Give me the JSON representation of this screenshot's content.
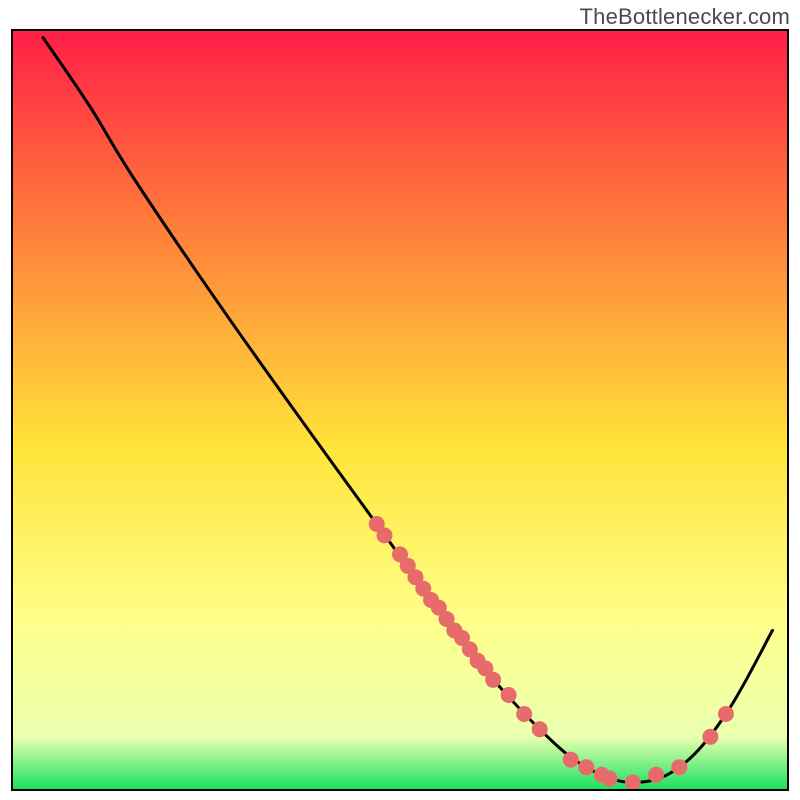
{
  "attribution": "TheBottlenecker.com",
  "chart_data": {
    "type": "line",
    "title": "",
    "xlabel": "",
    "ylabel": "",
    "xlim": [
      0,
      100
    ],
    "ylim": [
      0,
      100
    ],
    "background": {
      "type": "vertical-gradient",
      "stops": [
        {
          "offset": 0.0,
          "color": "#ff1e47"
        },
        {
          "offset": 0.25,
          "color": "#ff7a3a"
        },
        {
          "offset": 0.55,
          "color": "#ffe43a"
        },
        {
          "offset": 0.78,
          "color": "#ffff8a"
        },
        {
          "offset": 0.93,
          "color": "#eaffb0"
        },
        {
          "offset": 1.0,
          "color": "#18e060"
        }
      ]
    },
    "series": [
      {
        "name": "bottleneck-curve",
        "color": "#000000",
        "points": [
          {
            "x": 4,
            "y": 99
          },
          {
            "x": 10,
            "y": 90
          },
          {
            "x": 16,
            "y": 80
          },
          {
            "x": 28,
            "y": 62
          },
          {
            "x": 42,
            "y": 42
          },
          {
            "x": 52,
            "y": 28
          },
          {
            "x": 60,
            "y": 17
          },
          {
            "x": 68,
            "y": 8
          },
          {
            "x": 74,
            "y": 3
          },
          {
            "x": 80,
            "y": 1
          },
          {
            "x": 86,
            "y": 3
          },
          {
            "x": 92,
            "y": 10
          },
          {
            "x": 98,
            "y": 21
          }
        ]
      }
    ],
    "markers": {
      "name": "data-markers",
      "color": "#e86b6b",
      "radius": 8,
      "points": [
        {
          "x": 47,
          "y": 35
        },
        {
          "x": 48,
          "y": 33.5
        },
        {
          "x": 50,
          "y": 31
        },
        {
          "x": 51,
          "y": 29.5
        },
        {
          "x": 52,
          "y": 28
        },
        {
          "x": 53,
          "y": 26.5
        },
        {
          "x": 54,
          "y": 25
        },
        {
          "x": 55,
          "y": 24
        },
        {
          "x": 56,
          "y": 22.5
        },
        {
          "x": 57,
          "y": 21
        },
        {
          "x": 58,
          "y": 20
        },
        {
          "x": 59,
          "y": 18.5
        },
        {
          "x": 60,
          "y": 17
        },
        {
          "x": 61,
          "y": 16
        },
        {
          "x": 62,
          "y": 14.5
        },
        {
          "x": 64,
          "y": 12.5
        },
        {
          "x": 66,
          "y": 10
        },
        {
          "x": 68,
          "y": 8
        },
        {
          "x": 72,
          "y": 4
        },
        {
          "x": 74,
          "y": 3
        },
        {
          "x": 76,
          "y": 2
        },
        {
          "x": 77,
          "y": 1.5
        },
        {
          "x": 80,
          "y": 1
        },
        {
          "x": 83,
          "y": 2
        },
        {
          "x": 86,
          "y": 3
        },
        {
          "x": 90,
          "y": 7
        },
        {
          "x": 92,
          "y": 10
        }
      ]
    }
  }
}
